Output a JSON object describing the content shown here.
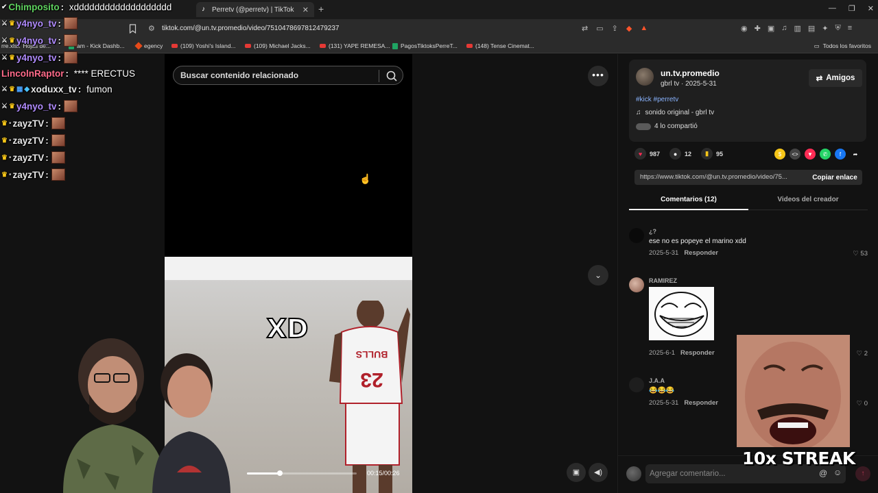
{
  "browser": {
    "tab_title": "Perretv (@perretv) | TikTok",
    "url": "tiktok.com/@un.tv.promedio/video/7510478697812479237",
    "bookmarks": [
      "Hojas de...",
      "am - Kick Dashb...",
      "egency",
      "(109) Yoshi's Island...",
      "(109) Michael Jacks...",
      "(131) YAPE REMESA...",
      "PagosTiktoksPerreT...",
      "(148) Tense Cinemat..."
    ],
    "bookmarks_prefix": "rre.xlsx",
    "all_bookmarks": "Todos los favoritos"
  },
  "video": {
    "search_placeholder": "Buscar contenido relacionado",
    "overlay_text": "XD",
    "jersey_number": "23",
    "jersey_team": "BULLS",
    "time": "00:15/00:26",
    "progress": 0.3
  },
  "post": {
    "username": "un.tv.promedio",
    "meta": "gbrl tv · 2025-5-31",
    "follow_label": "Amigos",
    "hashtags": "#kick #perretv",
    "sound": "sonido original - gbrl tv",
    "shared": "4 lo compartió",
    "likes": "987",
    "comments": "12",
    "saves": "95",
    "link": "https://www.tiktok.com/@un.tv.promedio/video/75...",
    "copy_label": "Copiar enlace",
    "tab_comments": "Comentarios (12)",
    "tab_videos": "Videos del creador"
  },
  "comments": [
    {
      "author": "¿?",
      "text": "ese no es popeye el marino xdd",
      "date": "2025-5-31",
      "reply": "Responder",
      "likes": "53"
    },
    {
      "author": "RAMIREZ",
      "text": "",
      "date": "2025-6-1",
      "reply": "Responder",
      "likes": "2"
    },
    {
      "author": "J.A.A",
      "text": "😂😂😂",
      "date": "2025-5-31",
      "reply": "Responder",
      "likes": "0"
    }
  ],
  "comment_input_placeholder": "Agregar comentario...",
  "chat": [
    {
      "user": "Chimposito",
      "msg": "xddddddddddddddddddd",
      "color": "#5fd35f"
    },
    {
      "user": "y4nyo_tv",
      "msg": "",
      "color": "#b18cff"
    },
    {
      "user": "y4nyo_tv",
      "msg": "",
      "color": "#b18cff"
    },
    {
      "user": "y4nyo_tv",
      "msg": "",
      "color": "#b18cff"
    },
    {
      "user": "LincolnRaptor",
      "msg": "**** ERECTUS",
      "color": "#ff6b8a"
    },
    {
      "user": "xoduxx_tv",
      "msg": "fumon",
      "color": "#ffffff"
    },
    {
      "user": "y4nyo_tv",
      "msg": "",
      "color": "#b18cff"
    },
    {
      "user": "zayzTV",
      "msg": "",
      "color": "#ffffff"
    },
    {
      "user": "zayzTV",
      "msg": "",
      "color": "#ffffff"
    },
    {
      "user": "zayzTV",
      "msg": "",
      "color": "#ffffff"
    },
    {
      "user": "zayzTV",
      "msg": "",
      "color": "#ffffff"
    }
  ],
  "streak": "10x STREAK",
  "colors": {
    "accent": "#fe2c55",
    "hashtag": "#8ab4ff"
  }
}
